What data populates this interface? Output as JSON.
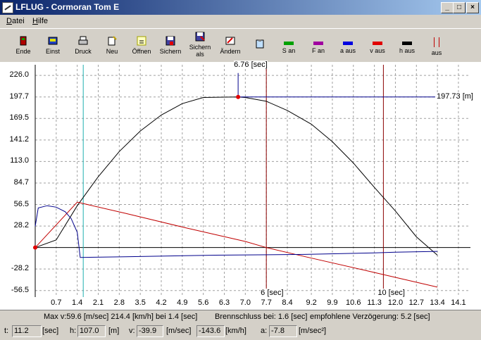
{
  "window": {
    "title": "LFLUG - Cormoran Tom E",
    "min_label": "_",
    "max_label": "□",
    "close_label": "×"
  },
  "menu": {
    "file": "Datei",
    "help": "Hilfe"
  },
  "toolbar": {
    "items": [
      {
        "label": "Ende",
        "icon": "exit-door-icon"
      },
      {
        "label": "Einst",
        "icon": "settings-icon"
      },
      {
        "label": "Druck",
        "icon": "printer-icon"
      },
      {
        "label": "Neu",
        "icon": "new-icon"
      },
      {
        "label": "Öffnen",
        "icon": "open-icon"
      },
      {
        "label": "Sichern",
        "icon": "save-icon"
      },
      {
        "label": "Sichern\nals",
        "icon": "save-as-icon"
      },
      {
        "label": "Ändern",
        "icon": "edit-icon"
      },
      {
        "label": "",
        "icon": "clipboard-icon"
      },
      {
        "label": "S an",
        "color": "#00a000"
      },
      {
        "label": "F an",
        "color": "#a000a0"
      },
      {
        "label": "a aus",
        "color": "#0000e0"
      },
      {
        "label": "v aus",
        "color": "#e00000"
      },
      {
        "label": "h aus",
        "color": "#000000"
      },
      {
        "label": "aus",
        "color": "#c00000"
      }
    ]
  },
  "chart_data": {
    "type": "line",
    "x_ticks": [
      "0.7",
      "1.4",
      "2.1",
      "2.8",
      "3.5",
      "4.2",
      "4.9",
      "5.6",
      "6.3",
      "7.0",
      "7.7",
      "8.4",
      "9.2",
      "9.9",
      "10.6",
      "11.3",
      "12.0",
      "12.7",
      "13.4",
      "14.1"
    ],
    "y_ticks": [
      "226.0",
      "197.7",
      "169.5",
      "141.2",
      "113.0",
      "84.7",
      "56.5",
      "28.2",
      "-28.2",
      "-56.5"
    ],
    "xlim": [
      0,
      14.5
    ],
    "ylim": [
      -65,
      240
    ],
    "series": [
      {
        "color": "#000000",
        "x": [
          0,
          0.7,
          1.4,
          2.1,
          2.8,
          3.5,
          4.2,
          4.9,
          5.6,
          6.3,
          6.76,
          7.0,
          7.7,
          8.4,
          9.2,
          9.9,
          10.6,
          11.3,
          12.0,
          12.7,
          13.4
        ],
        "y": [
          0,
          10,
          55,
          93,
          126,
          153,
          174,
          189,
          197,
          197.5,
          197.73,
          197,
          192,
          180,
          162,
          139,
          111,
          79,
          48,
          14,
          -10
        ]
      },
      {
        "color": "#c00000",
        "x": [
          0,
          1.4,
          3.0,
          5.0,
          7.0,
          7.7,
          9.0,
          11.0,
          13.4
        ],
        "y": [
          0,
          59.6,
          45,
          26,
          8,
          0,
          -12,
          -30,
          -52
        ]
      },
      {
        "color": "#00008b",
        "x": [
          0,
          0.1,
          0.4,
          0.7,
          1.0,
          1.2,
          1.4,
          1.5,
          3.0,
          6.0,
          9.0,
          11.3,
          12.0,
          13.4
        ],
        "y": [
          28,
          52,
          55,
          53,
          47,
          38,
          20,
          -13,
          -12,
          -10,
          -9,
          -7,
          -6,
          -5
        ]
      }
    ],
    "vlines": [
      {
        "x": 1.6,
        "color": "#20b0b0"
      },
      {
        "x": 7.7,
        "color": "#8b0000",
        "label": "6 [sec]"
      },
      {
        "x": 11.6,
        "color": "#8b0000",
        "label": "10 [sec]"
      }
    ],
    "annotations": {
      "peak_time": "6.76 [sec]",
      "peak_height": "197.73 [m]",
      "peak_x": 6.76,
      "peak_y": 197.73
    }
  },
  "info": {
    "max": "Max v:59.6 [m/sec] 214.4 [km/h] bei 1.4 [sec]",
    "burnout": "Brennschluss bei: 1.6 [sec]",
    "delay": "empfohlene Verzögerung: 5.2 [sec]"
  },
  "status": {
    "t_label": "t:",
    "t_value": "11.2",
    "t_unit": "[sec]",
    "h_label": "h:",
    "h_value": "107.0",
    "h_unit": "[m]",
    "v_label": "v:",
    "v_value": "-39.9",
    "v_unit": "[m/sec]",
    "v_kmh": "-143.6",
    "v_kmh_unit": "[km/h]",
    "a_label": "a:",
    "a_value": "-7.8",
    "a_unit": "[m/sec²]"
  }
}
